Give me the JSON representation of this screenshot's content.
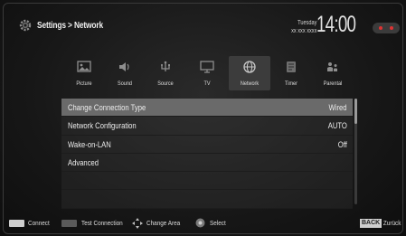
{
  "header": {
    "title": "Settings > Network",
    "day": "Tuesday",
    "date": "xx xxx xxxx",
    "time": "14:00"
  },
  "tabs": [
    {
      "label": "Picture",
      "icon": "picture-icon"
    },
    {
      "label": "Sound",
      "icon": "speaker-icon"
    },
    {
      "label": "Source",
      "icon": "source-icon"
    },
    {
      "label": "TV",
      "icon": "tv-icon"
    },
    {
      "label": "Network",
      "icon": "network-globe-icon",
      "active": true
    },
    {
      "label": "Timer",
      "icon": "timer-icon"
    },
    {
      "label": "Parental",
      "icon": "parental-icon"
    }
  ],
  "list": {
    "rows": [
      {
        "label": "Change Connection Type",
        "value": "Wired",
        "selected": true
      },
      {
        "label": "Network Configuration",
        "value": "AUTO"
      },
      {
        "label": "Wake-on-LAN",
        "value": "Off"
      },
      {
        "label": "Advanced",
        "value": ""
      },
      {
        "label": "",
        "value": ""
      },
      {
        "label": "",
        "value": ""
      }
    ]
  },
  "footer": {
    "connect": "Connect",
    "test_connection": "Test Connection",
    "change_area": "Change Area",
    "select": "Select",
    "back_key": "BACK",
    "back_label": "- Zurück"
  },
  "colors": {
    "background": "#171717",
    "selected_row": "#6a6a6a",
    "active_tab": "#3c3c3c",
    "status_red": "#dd3333"
  }
}
